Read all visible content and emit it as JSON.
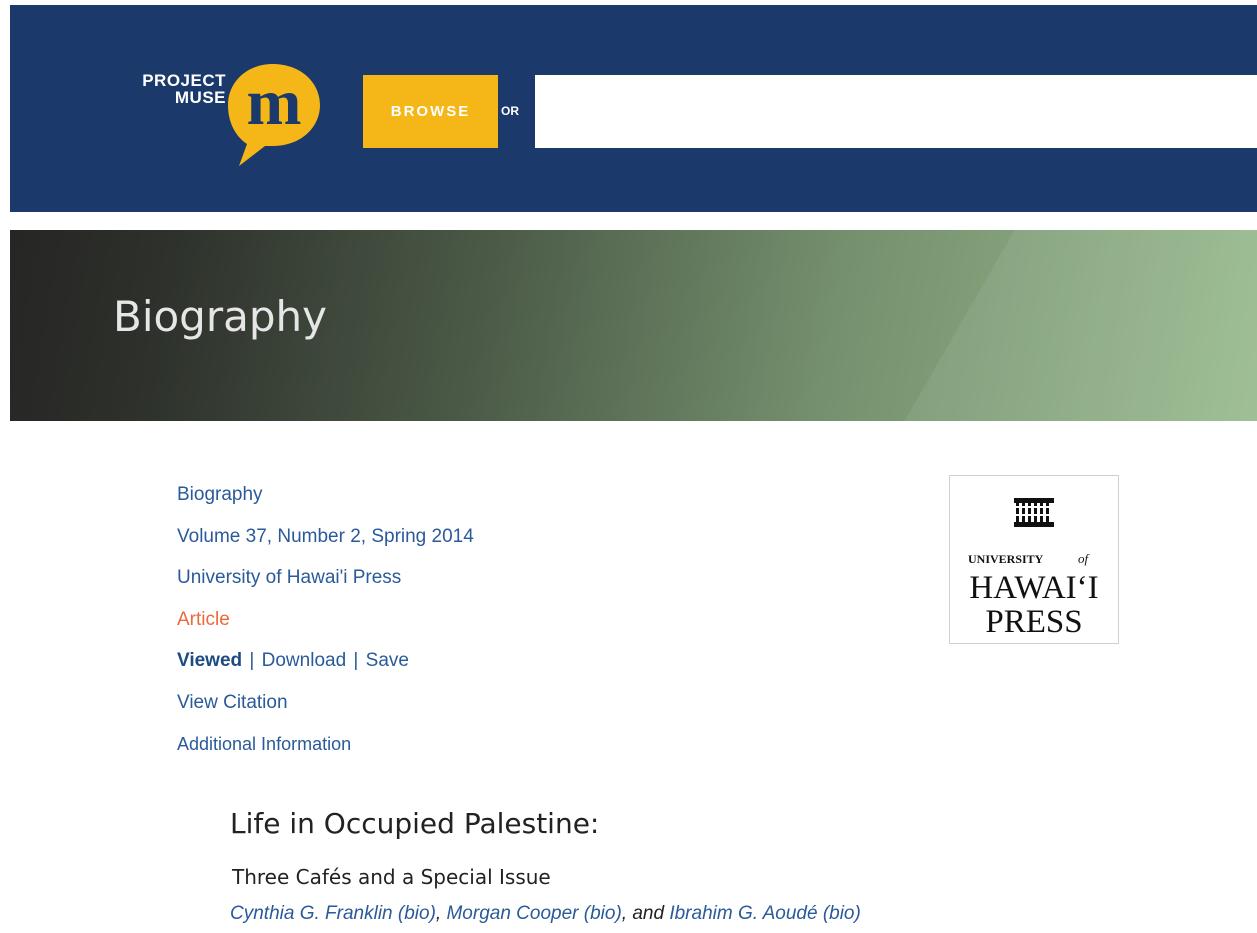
{
  "header": {
    "logo_text": [
      "PROJECT",
      "MUSE"
    ],
    "browse_label": "BROWSE",
    "or_label": "OR",
    "search_value": "",
    "colors": {
      "bar": "#1b3a6b",
      "accent": "#f5b617"
    }
  },
  "hero": {
    "title": "Biography"
  },
  "meta": {
    "journal": "Biography",
    "volume": "Volume 37, Number 2, Spring 2014",
    "publisher": "University of Hawai'i Press",
    "type": "Article",
    "viewed": "Viewed",
    "download": "Download",
    "save": "Save",
    "separator": "|",
    "view_citation": "View Citation",
    "additional_info": "Additional Information"
  },
  "publisher_logo": {
    "line1": "UNIVERSITY",
    "line1_of": "of",
    "line2": "HAWAI‘I",
    "line3": "PRESS"
  },
  "article": {
    "title": "Life in Occupied Palestine:",
    "subtitle": "Three Cafés and a Special Issue",
    "authors": [
      {
        "name": "Cynthia G. Franklin (bio)",
        "after": ", "
      },
      {
        "name": "Morgan Cooper (bio)",
        "after": ", and "
      },
      {
        "name": "Ibrahim G. Aoudé (bio)",
        "after": ""
      }
    ]
  }
}
